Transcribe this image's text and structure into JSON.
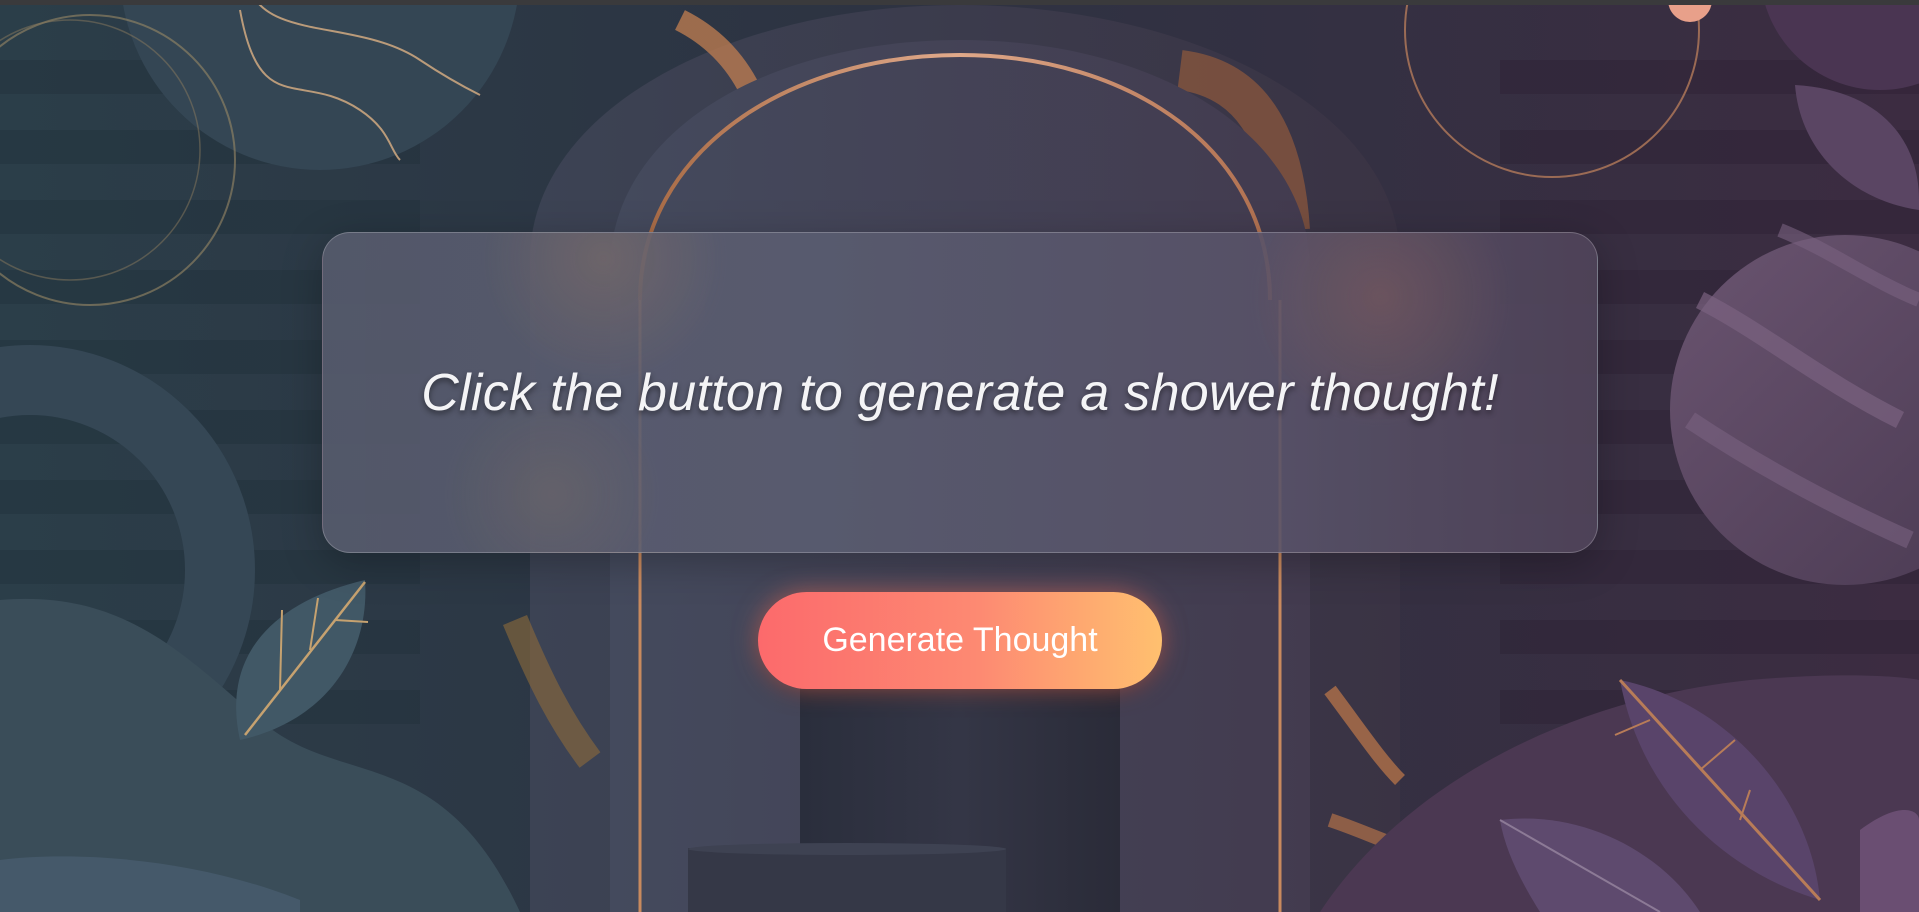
{
  "thought": {
    "text": "Click the button to generate a shower thought!"
  },
  "button": {
    "label": "Generate Thought"
  },
  "colors": {
    "button_gradient_start": "#fc6a6c",
    "button_gradient_end": "#ffc06f",
    "accent_copper": "#c98a5e",
    "background_left": "#2c3e4a",
    "background_right": "#3e2c42"
  }
}
